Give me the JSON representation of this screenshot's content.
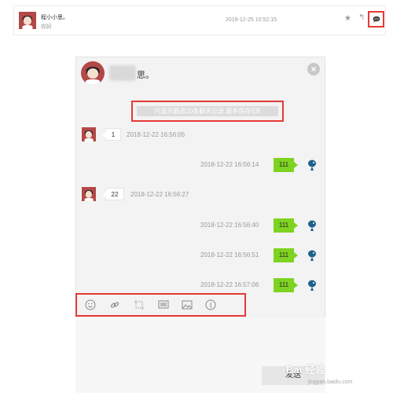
{
  "top_message": {
    "sender": "程小小思。",
    "preview": "你好",
    "time": "2018-12-25 10:52:15",
    "star_icon": "star-icon",
    "reply_icon": "reply-icon",
    "chat_icon": "chat-bubble-icon"
  },
  "chat": {
    "name": "思。",
    "notice": "只显示最近20条聊天记录,最多保存5天",
    "messages": [
      {
        "side": "left",
        "text": "1",
        "time": "2018-12-22 16:56:05"
      },
      {
        "side": "right",
        "text": "111",
        "time": "2018-12-22 16:56:14"
      },
      {
        "side": "left",
        "text": "22",
        "time": "2018-12-22 16:56:27"
      },
      {
        "side": "right",
        "text": "111",
        "time": "2018-12-22 16:56:40"
      },
      {
        "side": "right",
        "text": "111",
        "time": "2018-12-22 16:56:51"
      },
      {
        "side": "right",
        "text": "111",
        "time": "2018-12-22 16:57:06"
      }
    ],
    "toolbar": [
      "emoji-icon",
      "link-icon",
      "screenshot-icon",
      "screen-share-icon",
      "image-icon",
      "attachment-icon"
    ],
    "send_label": "发送"
  },
  "watermark": {
    "main": "Bai 经验",
    "sub": "jingyan.baidu.com"
  },
  "colors": {
    "accent_red": "#e53935",
    "bubble_green": "#7ed321",
    "avatar_red": "#b34848"
  }
}
